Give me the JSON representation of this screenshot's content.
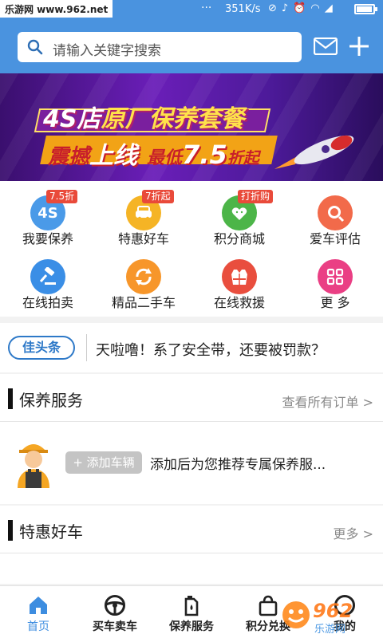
{
  "status_bar": {
    "watermark": "乐游网 www.962.net",
    "dots": "···",
    "speed": "351K/s",
    "icons": [
      "no-sim-icon",
      "mute-icon",
      "alarm-icon",
      "wifi-icon",
      "signal-icon"
    ],
    "battery_level": 0.85
  },
  "header": {
    "search_placeholder": "请输入关键字搜索",
    "icons": [
      "search-icon",
      "mail-icon",
      "plus-icon"
    ],
    "bg_color": "#4a93df"
  },
  "banner": {
    "line1_a": "4S店",
    "line1_b": "原厂保养套餐",
    "line2_a": "震撼",
    "line2_b": "上线",
    "line2_c": "最低",
    "line2_d": "7.5",
    "line2_e": "折起"
  },
  "grid": {
    "items": [
      {
        "label": "我要保养",
        "tag": "7.5折",
        "icon": "4s-icon",
        "color": "#4a9ae8",
        "badge": "4S"
      },
      {
        "label": "特惠好车",
        "tag": "7折起",
        "icon": "car-icon",
        "color": "#f5b425"
      },
      {
        "label": "积分商城",
        "tag": "打折购",
        "icon": "gift-icon",
        "color": "#4cb548"
      },
      {
        "label": "爱车评估",
        "tag": "",
        "icon": "magnifier-icon",
        "color": "#f26a4a"
      },
      {
        "label": "在线拍卖",
        "tag": "",
        "icon": "gavel-icon",
        "color": "#3a8ee6"
      },
      {
        "label": "精品二手车",
        "tag": "",
        "icon": "refresh-icon",
        "color": "#f7962a"
      },
      {
        "label": "在线救援",
        "tag": "",
        "icon": "vest-icon",
        "color": "#e94e3e"
      },
      {
        "label": "更 多",
        "tag": "",
        "icon": "grid-icon",
        "color": "#ea3f84"
      }
    ]
  },
  "headline": {
    "logo": "佳头条",
    "text": "天啦噜！系了安全带，还要被罚款？"
  },
  "maintenance": {
    "title": "保养服务",
    "more": "查看所有订单 >",
    "add_button": "+ 添加车辆",
    "hint": "添加后为您推荐专属保养服..."
  },
  "deals": {
    "title": "特惠好车",
    "more": "更多 >"
  },
  "bottom_nav": {
    "items": [
      {
        "label": "首页",
        "icon": "home-icon"
      },
      {
        "label": "买车卖车",
        "icon": "steering-wheel-icon"
      },
      {
        "label": "保养服务",
        "icon": "oil-can-icon"
      },
      {
        "label": "积分兑换",
        "icon": "shopping-bag-icon"
      },
      {
        "label": "我的",
        "icon": "user-icon"
      }
    ],
    "active_color": "#3d8de0"
  },
  "watermark_962": {
    "number": "962",
    "brand": "乐游网"
  }
}
